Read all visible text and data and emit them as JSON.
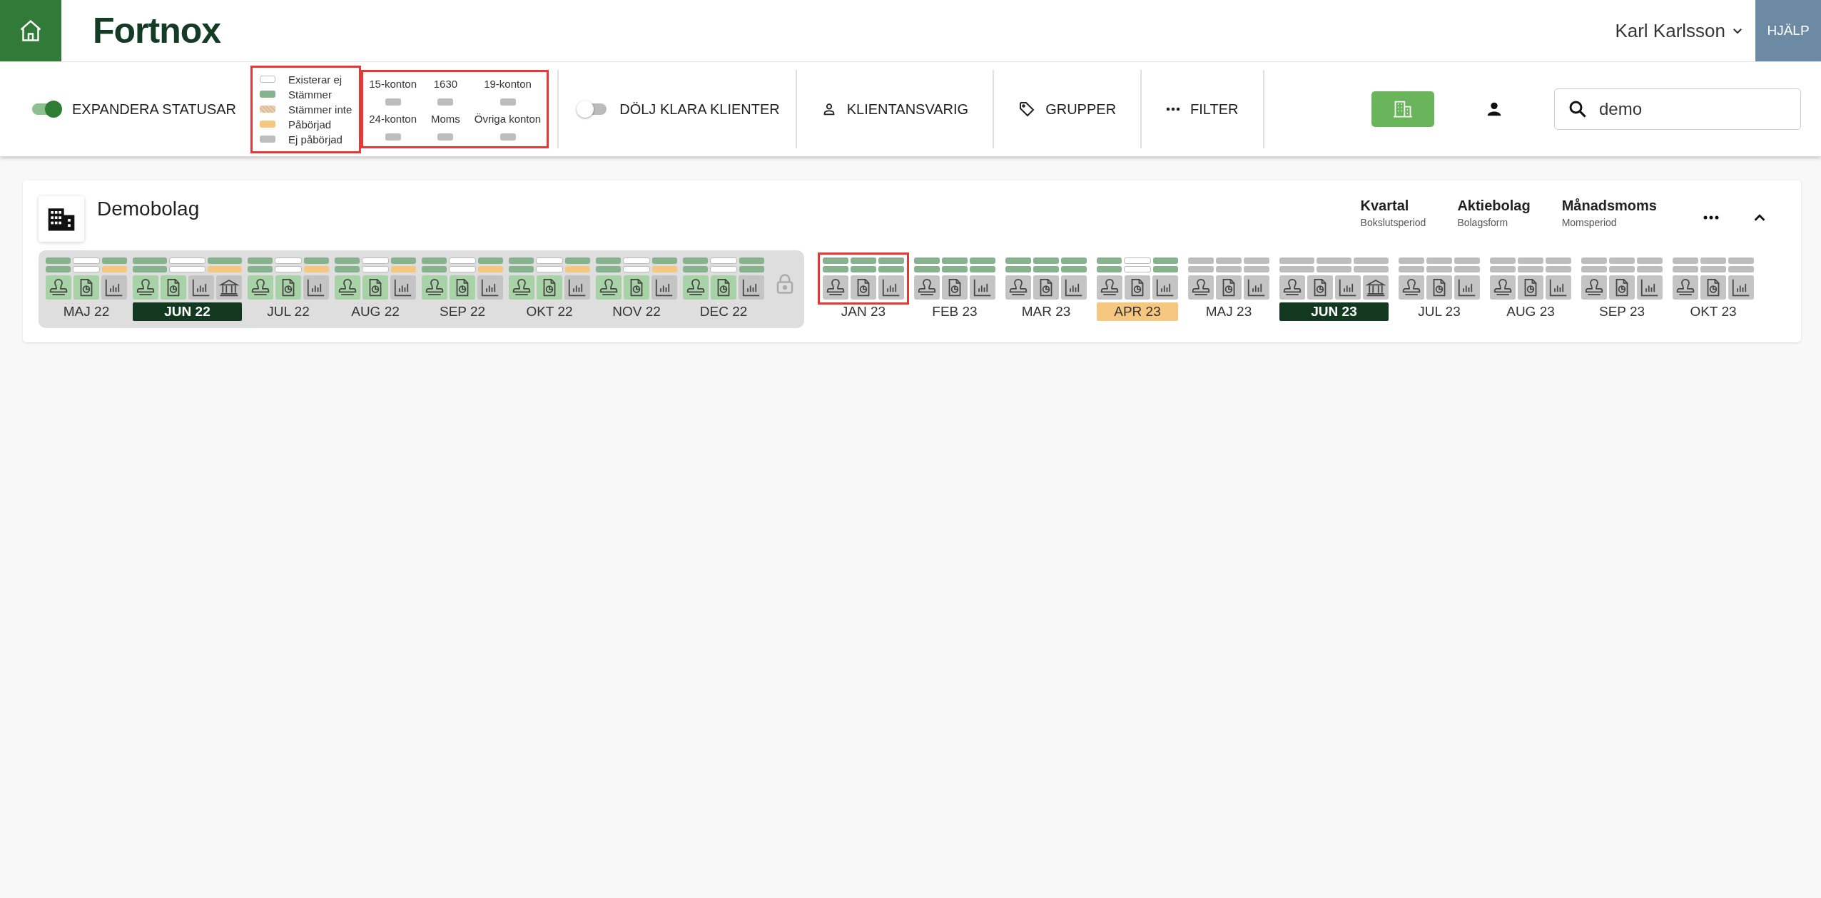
{
  "header": {
    "logo": "Fortnox",
    "user": "Karl Karlsson",
    "help": "HJÄLP"
  },
  "toolbar": {
    "expand_toggle": {
      "label": "EXPANDERA STATUSAR",
      "on": true
    },
    "legend": {
      "highlighted": true,
      "items": [
        {
          "kind": "none",
          "label": "Existerar ej"
        },
        {
          "kind": "ok",
          "label": "Stämmer"
        },
        {
          "kind": "mismatch",
          "label": "Stämmer inte"
        },
        {
          "kind": "started",
          "label": "Påbörjad"
        },
        {
          "kind": "pending",
          "label": "Ej påbörjad"
        }
      ]
    },
    "accounts": {
      "highlighted": true,
      "items": [
        {
          "label": "15-konton",
          "kind": "pending"
        },
        {
          "label": "1630",
          "kind": "pending"
        },
        {
          "label": "19-konton",
          "kind": "pending"
        },
        {
          "label": "24-konton",
          "kind": "pending"
        },
        {
          "label": "Moms",
          "kind": "pending"
        },
        {
          "label": "Övriga konton",
          "kind": "pending"
        }
      ]
    },
    "hide_toggle": {
      "label": "DÖLJ KLARA KLIENTER",
      "on": false
    },
    "filters": [
      {
        "kind": "person",
        "label": "KLIENTANSVARIG"
      },
      {
        "kind": "tag",
        "label": "GRUPPER"
      },
      {
        "kind": "dots",
        "label": "FILTER"
      }
    ],
    "views": [
      {
        "kind": "company",
        "selected": true
      },
      {
        "kind": "person",
        "selected": false
      }
    ],
    "search": {
      "value": "demo"
    }
  },
  "client": {
    "name": "Demobolag",
    "info": [
      {
        "value": "Kvartal",
        "caption": "Bokslutsperiod"
      },
      {
        "value": "Aktiebolag",
        "caption": "Bolagsform"
      },
      {
        "value": "Månadsmoms",
        "caption": "Momsperiod"
      }
    ],
    "expanded": true,
    "closed_period": {
      "locked": true,
      "months": [
        {
          "label": "MAJ 22",
          "current": false,
          "overdue": false,
          "highlighted": false,
          "rows": [
            [
              {
                "kind": "ok"
              },
              {
                "kind": "none"
              },
              {
                "kind": "ok"
              }
            ],
            [
              {
                "kind": "ok"
              },
              {
                "kind": "none"
              },
              {
                "kind": "started"
              }
            ]
          ],
          "icons": [
            {
              "kind": "stamp",
              "done": true
            },
            {
              "kind": "doc",
              "done": true
            },
            {
              "kind": "chart",
              "done": false
            }
          ]
        },
        {
          "label": "JUN 22",
          "current": true,
          "overdue": false,
          "highlighted": false,
          "rows": [
            [
              {
                "kind": "ok"
              },
              {
                "kind": "none"
              },
              {
                "kind": "ok"
              }
            ],
            [
              {
                "kind": "ok"
              },
              {
                "kind": "none"
              },
              {
                "kind": "started"
              }
            ]
          ],
          "icons": [
            {
              "kind": "stamp",
              "done": true
            },
            {
              "kind": "doc",
              "done": true
            },
            {
              "kind": "chart",
              "done": false
            },
            {
              "kind": "bank",
              "done": false
            }
          ]
        },
        {
          "label": "JUL 22",
          "current": false,
          "overdue": false,
          "highlighted": false,
          "rows": [
            [
              {
                "kind": "ok"
              },
              {
                "kind": "none"
              },
              {
                "kind": "ok"
              }
            ],
            [
              {
                "kind": "ok"
              },
              {
                "kind": "none"
              },
              {
                "kind": "started"
              }
            ]
          ],
          "icons": [
            {
              "kind": "stamp",
              "done": true
            },
            {
              "kind": "doc",
              "done": true
            },
            {
              "kind": "chart",
              "done": false
            }
          ]
        },
        {
          "label": "AUG 22",
          "current": false,
          "overdue": false,
          "highlighted": false,
          "rows": [
            [
              {
                "kind": "ok"
              },
              {
                "kind": "none"
              },
              {
                "kind": "ok"
              }
            ],
            [
              {
                "kind": "ok"
              },
              {
                "kind": "none"
              },
              {
                "kind": "started"
              }
            ]
          ],
          "icons": [
            {
              "kind": "stamp",
              "done": true
            },
            {
              "kind": "doc",
              "done": true
            },
            {
              "kind": "chart",
              "done": false
            }
          ]
        },
        {
          "label": "SEP 22",
          "current": false,
          "overdue": false,
          "highlighted": false,
          "rows": [
            [
              {
                "kind": "ok"
              },
              {
                "kind": "none"
              },
              {
                "kind": "ok"
              }
            ],
            [
              {
                "kind": "ok"
              },
              {
                "kind": "none"
              },
              {
                "kind": "started"
              }
            ]
          ],
          "icons": [
            {
              "kind": "stamp",
              "done": true
            },
            {
              "kind": "doc",
              "done": true
            },
            {
              "kind": "chart",
              "done": false
            }
          ]
        },
        {
          "label": "OKT 22",
          "current": false,
          "overdue": false,
          "highlighted": false,
          "rows": [
            [
              {
                "kind": "ok"
              },
              {
                "kind": "none"
              },
              {
                "kind": "ok"
              }
            ],
            [
              {
                "kind": "ok"
              },
              {
                "kind": "none"
              },
              {
                "kind": "started"
              }
            ]
          ],
          "icons": [
            {
              "kind": "stamp",
              "done": true
            },
            {
              "kind": "doc",
              "done": true
            },
            {
              "kind": "chart",
              "done": false
            }
          ]
        },
        {
          "label": "NOV 22",
          "current": false,
          "overdue": false,
          "highlighted": false,
          "rows": [
            [
              {
                "kind": "ok"
              },
              {
                "kind": "none"
              },
              {
                "kind": "ok"
              }
            ],
            [
              {
                "kind": "ok"
              },
              {
                "kind": "none"
              },
              {
                "kind": "started"
              }
            ]
          ],
          "icons": [
            {
              "kind": "stamp",
              "done": true
            },
            {
              "kind": "doc",
              "done": true
            },
            {
              "kind": "chart",
              "done": false
            }
          ]
        },
        {
          "label": "DEC 22",
          "current": false,
          "overdue": false,
          "highlighted": false,
          "rows": [
            [
              {
                "kind": "ok"
              },
              {
                "kind": "none"
              },
              {
                "kind": "ok"
              }
            ],
            [
              {
                "kind": "ok"
              },
              {
                "kind": "none"
              },
              {
                "kind": "ok"
              }
            ]
          ],
          "icons": [
            {
              "kind": "stamp",
              "done": true
            },
            {
              "kind": "doc",
              "done": true
            },
            {
              "kind": "chart",
              "done": false
            }
          ]
        }
      ]
    },
    "open_months": [
      {
        "label": "JAN 23",
        "current": false,
        "overdue": false,
        "highlighted": true,
        "rows": [
          [
            {
              "kind": "ok"
            },
            {
              "kind": "ok"
            },
            {
              "kind": "ok"
            }
          ],
          [
            {
              "kind": "ok"
            },
            {
              "kind": "ok"
            },
            {
              "kind": "ok"
            }
          ]
        ],
        "icons": [
          {
            "kind": "stamp",
            "done": false
          },
          {
            "kind": "doc",
            "done": false
          },
          {
            "kind": "chart",
            "done": false
          }
        ]
      },
      {
        "label": "FEB 23",
        "current": false,
        "overdue": false,
        "highlighted": false,
        "rows": [
          [
            {
              "kind": "ok"
            },
            {
              "kind": "ok"
            },
            {
              "kind": "ok"
            }
          ],
          [
            {
              "kind": "ok"
            },
            {
              "kind": "ok"
            },
            {
              "kind": "ok"
            }
          ]
        ],
        "icons": [
          {
            "kind": "stamp",
            "done": false
          },
          {
            "kind": "doc",
            "done": false
          },
          {
            "kind": "chart",
            "done": false
          }
        ]
      },
      {
        "label": "MAR 23",
        "current": false,
        "overdue": false,
        "highlighted": false,
        "rows": [
          [
            {
              "kind": "ok"
            },
            {
              "kind": "ok"
            },
            {
              "kind": "ok"
            }
          ],
          [
            {
              "kind": "ok"
            },
            {
              "kind": "ok"
            },
            {
              "kind": "ok"
            }
          ]
        ],
        "icons": [
          {
            "kind": "stamp",
            "done": false
          },
          {
            "kind": "doc",
            "done": false
          },
          {
            "kind": "chart",
            "done": false
          }
        ]
      },
      {
        "label": "APR 23",
        "current": false,
        "overdue": true,
        "highlighted": false,
        "rows": [
          [
            {
              "kind": "ok"
            },
            {
              "kind": "none"
            },
            {
              "kind": "ok"
            }
          ],
          [
            {
              "kind": "ok"
            },
            {
              "kind": "none"
            },
            {
              "kind": "ok"
            }
          ]
        ],
        "icons": [
          {
            "kind": "stamp",
            "done": false
          },
          {
            "kind": "doc",
            "done": false
          },
          {
            "kind": "chart",
            "done": false
          }
        ]
      },
      {
        "label": "MAJ 23",
        "current": false,
        "overdue": false,
        "highlighted": false,
        "rows": [
          [
            {
              "kind": "pending"
            },
            {
              "kind": "pending"
            },
            {
              "kind": "pending"
            }
          ],
          [
            {
              "kind": "pending"
            },
            {
              "kind": "pending"
            },
            {
              "kind": "pending"
            }
          ]
        ],
        "icons": [
          {
            "kind": "stamp",
            "done": false
          },
          {
            "kind": "doc",
            "done": false
          },
          {
            "kind": "chart",
            "done": false
          }
        ]
      },
      {
        "label": "JUN 23",
        "current": true,
        "overdue": false,
        "highlighted": false,
        "rows": [
          [
            {
              "kind": "pending"
            },
            {
              "kind": "pending"
            },
            {
              "kind": "pending"
            }
          ],
          [
            {
              "kind": "pending"
            },
            {
              "kind": "pending"
            },
            {
              "kind": "pending"
            }
          ]
        ],
        "icons": [
          {
            "kind": "stamp",
            "done": false
          },
          {
            "kind": "doc",
            "done": false
          },
          {
            "kind": "chart",
            "done": false
          },
          {
            "kind": "bank",
            "done": false
          }
        ]
      },
      {
        "label": "JUL 23",
        "current": false,
        "overdue": false,
        "highlighted": false,
        "rows": [
          [
            {
              "kind": "pending"
            },
            {
              "kind": "pending"
            },
            {
              "kind": "pending"
            }
          ],
          [
            {
              "kind": "pending"
            },
            {
              "kind": "pending"
            },
            {
              "kind": "pending"
            }
          ]
        ],
        "icons": [
          {
            "kind": "stamp",
            "done": false
          },
          {
            "kind": "doc",
            "done": false
          },
          {
            "kind": "chart",
            "done": false
          }
        ]
      },
      {
        "label": "AUG 23",
        "current": false,
        "overdue": false,
        "highlighted": false,
        "rows": [
          [
            {
              "kind": "pending"
            },
            {
              "kind": "pending"
            },
            {
              "kind": "pending"
            }
          ],
          [
            {
              "kind": "pending"
            },
            {
              "kind": "pending"
            },
            {
              "kind": "pending"
            }
          ]
        ],
        "icons": [
          {
            "kind": "stamp",
            "done": false
          },
          {
            "kind": "doc",
            "done": false
          },
          {
            "kind": "chart",
            "done": false
          }
        ]
      },
      {
        "label": "SEP 23",
        "current": false,
        "overdue": false,
        "highlighted": false,
        "rows": [
          [
            {
              "kind": "pending"
            },
            {
              "kind": "pending"
            },
            {
              "kind": "pending"
            }
          ],
          [
            {
              "kind": "pending"
            },
            {
              "kind": "pending"
            },
            {
              "kind": "pending"
            }
          ]
        ],
        "icons": [
          {
            "kind": "stamp",
            "done": false
          },
          {
            "kind": "doc",
            "done": false
          },
          {
            "kind": "chart",
            "done": false
          }
        ]
      },
      {
        "label": "OKT 23",
        "current": false,
        "overdue": false,
        "highlighted": false,
        "rows": [
          [
            {
              "kind": "pending"
            },
            {
              "kind": "pending"
            },
            {
              "kind": "pending"
            }
          ],
          [
            {
              "kind": "pending"
            },
            {
              "kind": "pending"
            },
            {
              "kind": "pending"
            }
          ]
        ],
        "icons": [
          {
            "kind": "stamp",
            "done": false
          },
          {
            "kind": "doc",
            "done": false
          },
          {
            "kind": "chart",
            "done": false
          }
        ]
      }
    ]
  }
}
